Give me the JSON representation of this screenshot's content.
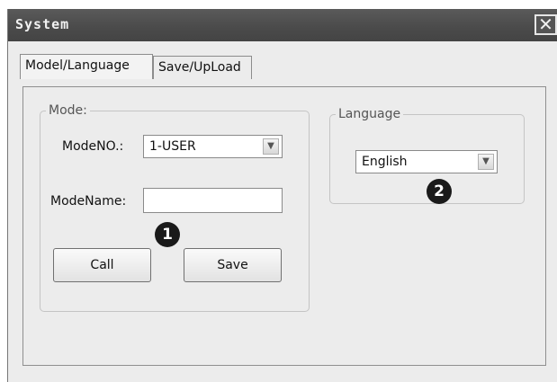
{
  "window": {
    "title": "System",
    "close_glyph": "✕"
  },
  "tabs": [
    {
      "label": "Model/Language",
      "active": true
    },
    {
      "label": "Save/UpLoad",
      "active": false
    }
  ],
  "mode_group": {
    "legend": "Mode:",
    "mode_no_label": "ModeNO.:",
    "mode_no_value": "1-USER",
    "mode_name_label": "ModeName:",
    "mode_name_value": "",
    "call_button": "Call",
    "save_button": "Save"
  },
  "language_group": {
    "legend": "Language",
    "language_value": "English"
  },
  "callouts": [
    "1",
    "2"
  ],
  "icons": {
    "dropdown": "chevron-down-icon",
    "close": "close-icon"
  }
}
